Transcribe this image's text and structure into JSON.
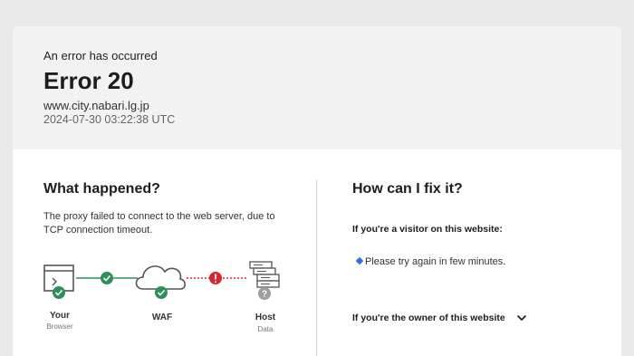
{
  "header": {
    "subtitle": "An error has occurred",
    "title": "Error 20",
    "host": "www.city.nabari.lg.jp",
    "timestamp": "2024-07-30 03:22:38 UTC"
  },
  "what_happened": {
    "heading": "What happened?",
    "text": "The proxy failed to connect to the web server, due to TCP connection timeout."
  },
  "diagram": {
    "nodes": [
      {
        "label": "Your",
        "sublabel": "Browser",
        "icon": "browser-icon",
        "status": "ok"
      },
      {
        "label": "WAF",
        "sublabel": "",
        "icon": "cloud-icon",
        "status": "ok"
      },
      {
        "label": "Host",
        "sublabel": "Data",
        "icon": "server-icon",
        "status": "unknown"
      }
    ],
    "links": [
      {
        "status": "ok"
      },
      {
        "status": "error"
      }
    ],
    "colors": {
      "ok": "#2f8f5b",
      "error": "#d8262e",
      "unknown": "#9e9e9e"
    }
  },
  "fix": {
    "heading": "How can I fix it?",
    "visitor_label": "If you're a visitor on this website:",
    "visitor_tip": "Please try again in few minutes.",
    "owner_label": "If you're the owner of this website"
  }
}
